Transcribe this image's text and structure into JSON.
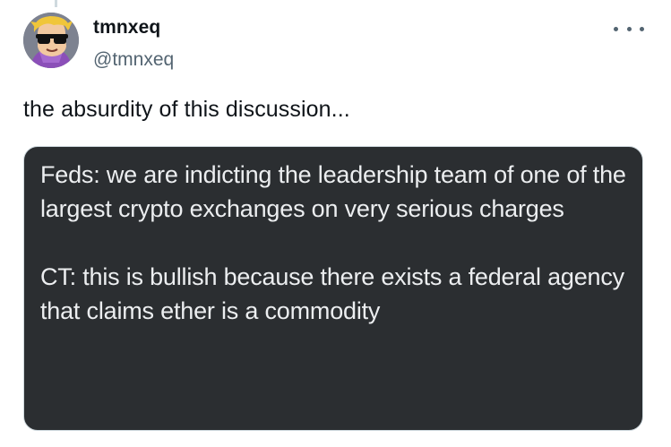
{
  "tweet": {
    "display_name": "tmnxeq",
    "handle": "@tmnxeq",
    "text": "the absurdity of this discussion...",
    "more_icon": "more-horizontal-icon",
    "avatar_icon": "avatar-cartoon-sunglasses"
  },
  "media": {
    "paragraphs": [
      "Feds: we are indicting the leadership team of one of the largest crypto exchanges on very serious charges",
      "CT: this is bullish because there exists a federal agency that claims ether is a commodity"
    ]
  },
  "colors": {
    "text_primary": "#0f1419",
    "text_secondary": "#536471",
    "media_background": "#2b2e31",
    "media_text": "#eceef0",
    "border": "#cfd9de"
  }
}
